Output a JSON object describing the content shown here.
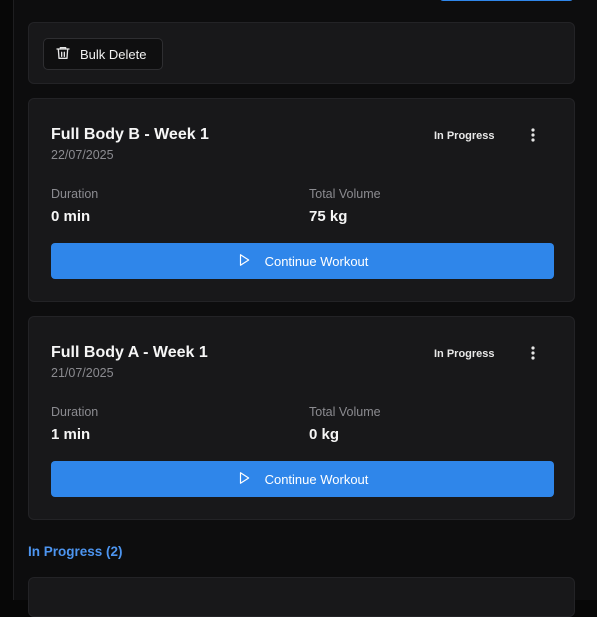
{
  "toolbar": {
    "bulk_delete_label": "Bulk Delete",
    "bulk_delete_icon": "trash-icon"
  },
  "workouts": [
    {
      "title": "Full Body B - Week 1",
      "date": "22/07/2025",
      "status": "In Progress",
      "duration_label": "Duration",
      "duration_value": "0 min",
      "volume_label": "Total Volume",
      "volume_value": "75 kg",
      "action_label": "Continue Workout",
      "action_icon": "play-icon",
      "menu_icon": "more-vertical-icon"
    },
    {
      "title": "Full Body A - Week 1",
      "date": "21/07/2025",
      "status": "In Progress",
      "duration_label": "Duration",
      "duration_value": "1 min",
      "volume_label": "Total Volume",
      "volume_value": "0 kg",
      "action_label": "Continue Workout",
      "action_icon": "play-icon",
      "menu_icon": "more-vertical-icon"
    }
  ],
  "section": {
    "heading": "In Progress (2)"
  },
  "colors": {
    "accent": "#2f86ea",
    "section_heading": "#4d95f0",
    "card_background": "#18181a",
    "page_background": "#0d0d0e"
  }
}
